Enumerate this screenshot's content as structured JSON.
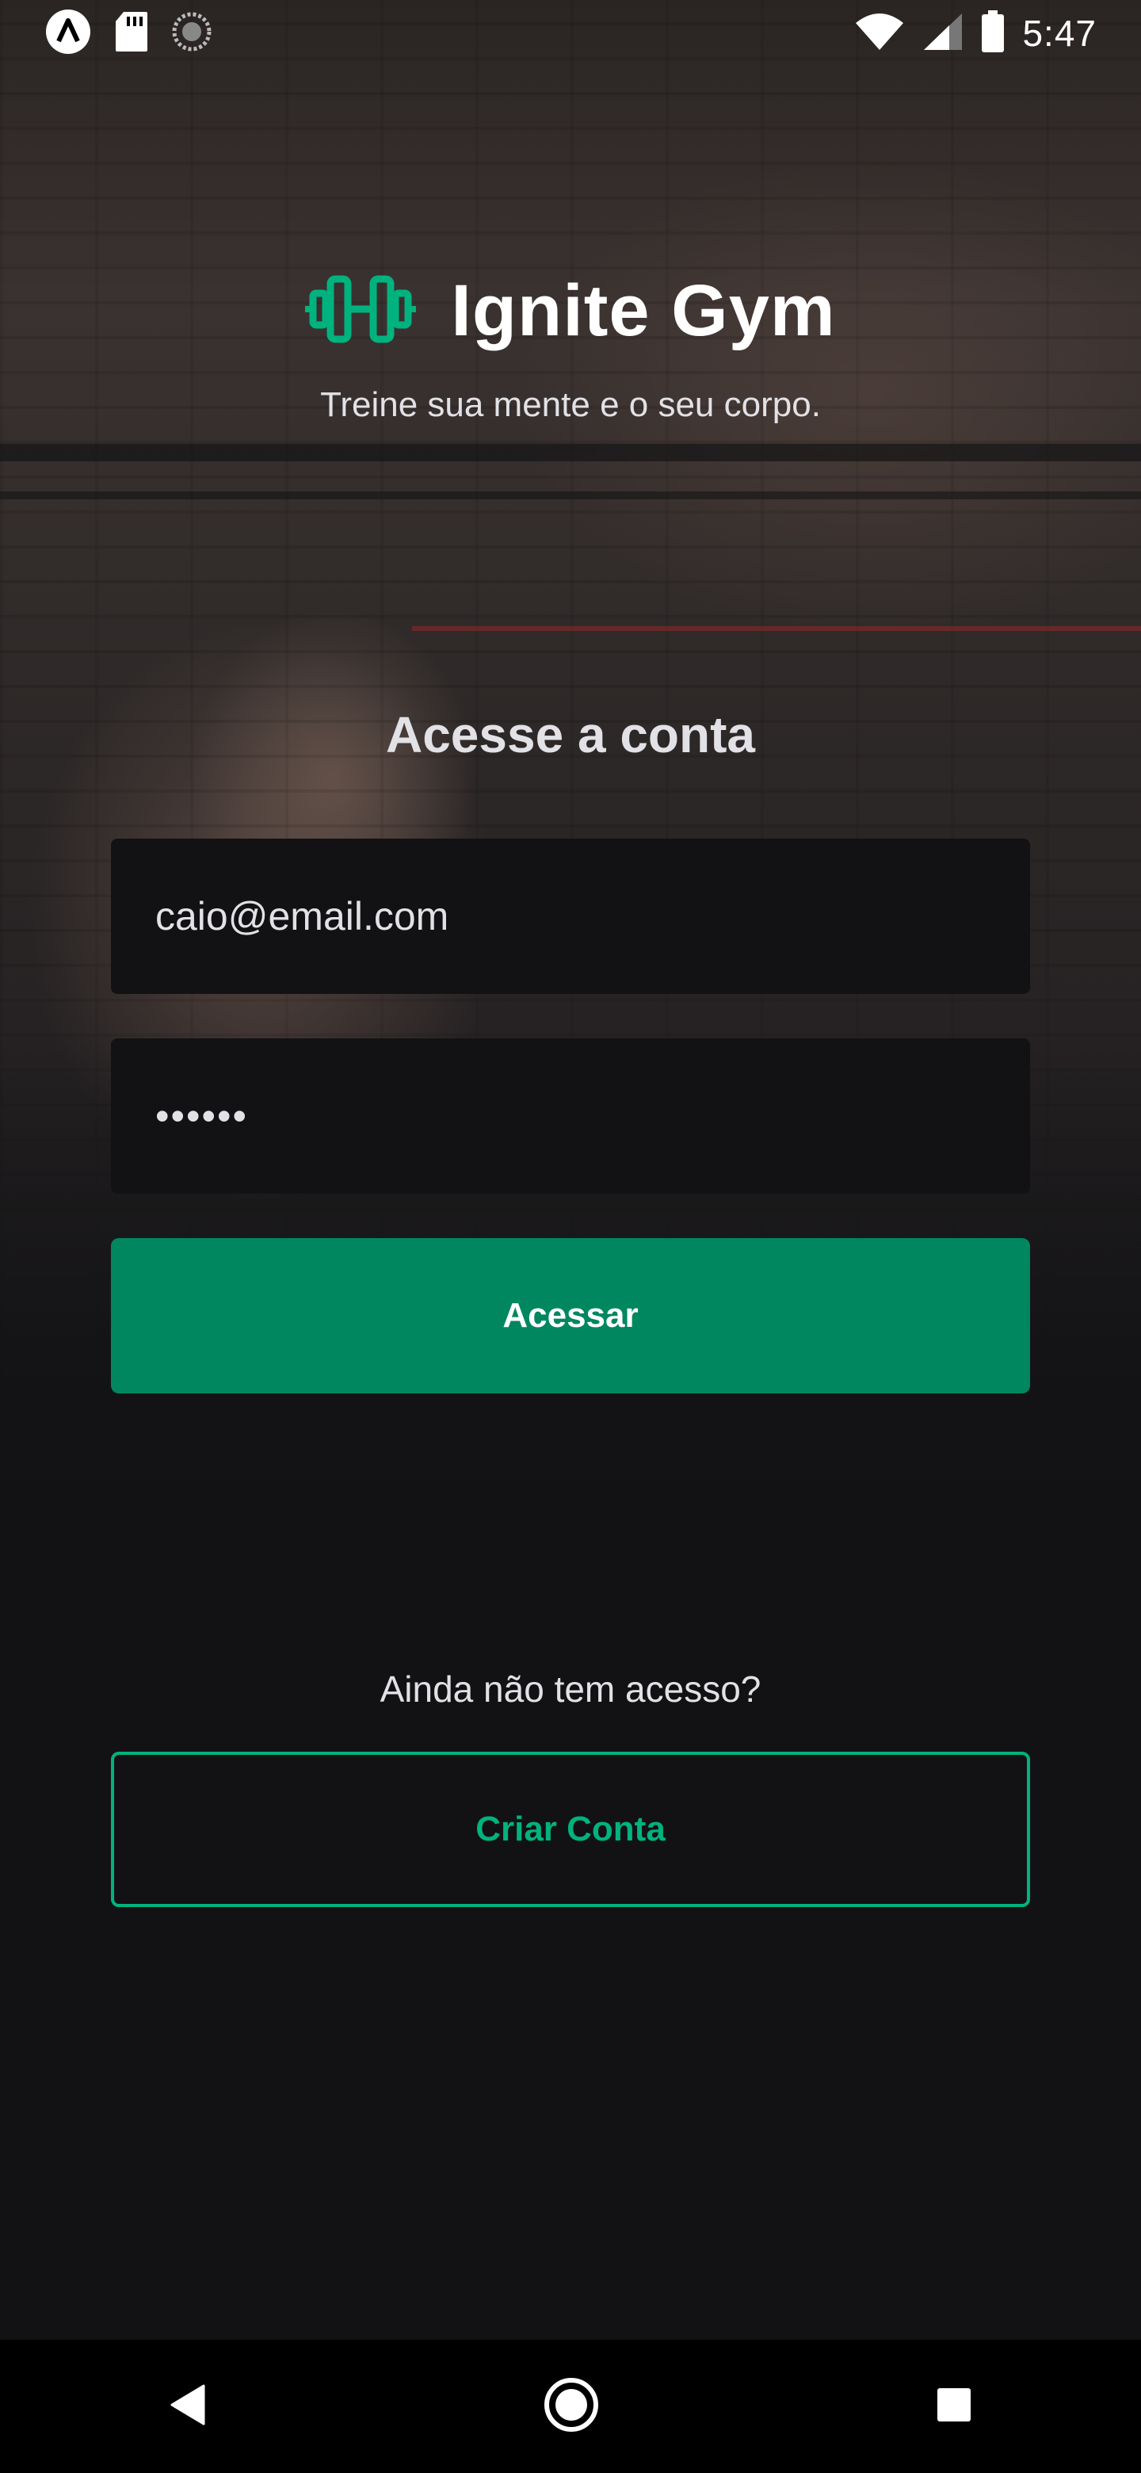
{
  "status_bar": {
    "time": "5:47",
    "icons": [
      "app-icon",
      "sd-card-icon",
      "sync-icon",
      "wifi-icon",
      "signal-icon",
      "battery-icon"
    ]
  },
  "brand": {
    "title": "Ignite Gym",
    "tagline": "Treine sua mente e o seu corpo.",
    "accent_color": "#00B37E"
  },
  "login": {
    "heading": "Acesse a conta",
    "email_value": "caio@email.com",
    "password_masked": "••••••",
    "submit_label": "Acessar",
    "primary_color": "#00875F"
  },
  "signup": {
    "prompt": "Ainda não tem acesso?",
    "button_label": "Criar Conta"
  },
  "nav_bar": {
    "icons": [
      "back-icon",
      "home-icon",
      "recents-icon"
    ]
  }
}
